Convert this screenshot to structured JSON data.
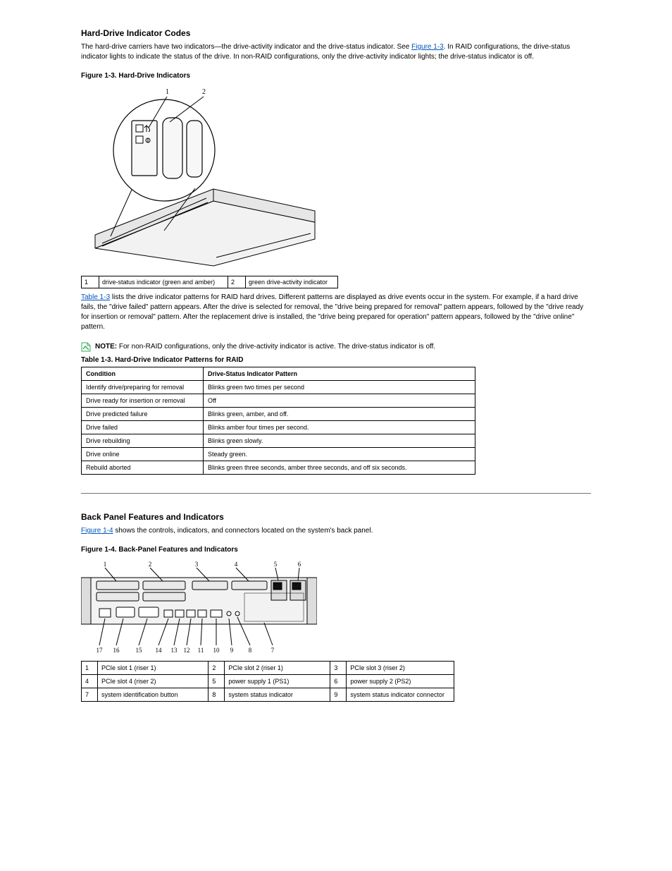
{
  "hard_drive": {
    "heading": "Hard-Drive Indicator Codes",
    "intro_a": "The hard-drive carriers have two indicators",
    "intro_b": "the drive-activity indicator and the drive-status indicator. See ",
    "figure_link": "Figure 1-3",
    "intro_c": ". In RAID configurations, the drive-status indicator lights to indicate the status of the drive. In non-RAID configurations, only the drive-activity indicator lights; the drive-status indicator is off.",
    "figure_label": "Figure 1-3.   Hard-Drive Indicators",
    "callouts": {
      "c1": "drive-status indicator (green and amber)",
      "c2": "green drive-activity indicator"
    },
    "raid_intro_a": "Table 1-3",
    "raid_intro_b": " lists the drive indicator patterns for RAID hard drives. Different patterns are displayed as drive events occur in the system. For example, if a hard drive fails, the \"drive failed\" pattern appears. After the drive is selected for removal, the \"drive being prepared for removal\" pattern appears, followed by the \"drive ready for insertion or removal\" pattern. After the replacement drive is installed, the \"drive being prepared for operation\" pattern appears, followed by the \"drive online\" pattern.",
    "note_text": " For non-RAID configurations, only the drive-activity indicator is active. The drive-status indicator is off.",
    "note_bold": "NOTE:",
    "raid_caption_a": "Table 1-3.   Hard-",
    "raid_caption_b": "Drive Indicator Patterns for RAID",
    "table_header_condition": "Condition",
    "table_header_pattern": "Drive-Status Indicator Pattern",
    "rows": [
      {
        "cond": "Identify drive/preparing for removal",
        "pat": "Blinks green two times per second"
      },
      {
        "cond": "Drive ready for insertion or removal",
        "pat": "Off"
      },
      {
        "cond": "Drive predicted failure",
        "pat": "Blinks green, amber, and off."
      },
      {
        "cond": "Drive failed",
        "pat": "Blinks amber four times per second."
      },
      {
        "cond": "Drive rebuilding",
        "pat": "Blinks green slowly."
      },
      {
        "cond": "Drive online",
        "pat": "Steady green."
      },
      {
        "cond": "Rebuild aborted",
        "pat": "Blinks green three seconds, amber three seconds, and off six seconds."
      }
    ]
  },
  "back_panel": {
    "heading": "Back Panel Features and Indicators",
    "intro_a": "Figure 1-4",
    "intro_b": " shows the controls, indicators, and connectors located on the system's back panel.",
    "figure_label": "Figure 1-4.   Back-Panel Features and Indicators",
    "callouts": [
      {
        "n": "1",
        "t": "PCIe slot 1 (riser 1)"
      },
      {
        "n": "2",
        "t": "PCIe slot 2 (riser 1)"
      },
      {
        "n": "3",
        "t": "PCIe slot 3 (riser 2)"
      },
      {
        "n": "4",
        "t": "PCIe slot 4 (riser 2)"
      },
      {
        "n": "5",
        "t": "power supply 1 (PS1)"
      },
      {
        "n": "6",
        "t": "power supply 2 (PS2)"
      },
      {
        "n": "7",
        "t": "system identification button"
      },
      {
        "n": "8",
        "t": "system status indicator"
      },
      {
        "n": "9",
        "t": "system status indicator connector"
      }
    ]
  }
}
